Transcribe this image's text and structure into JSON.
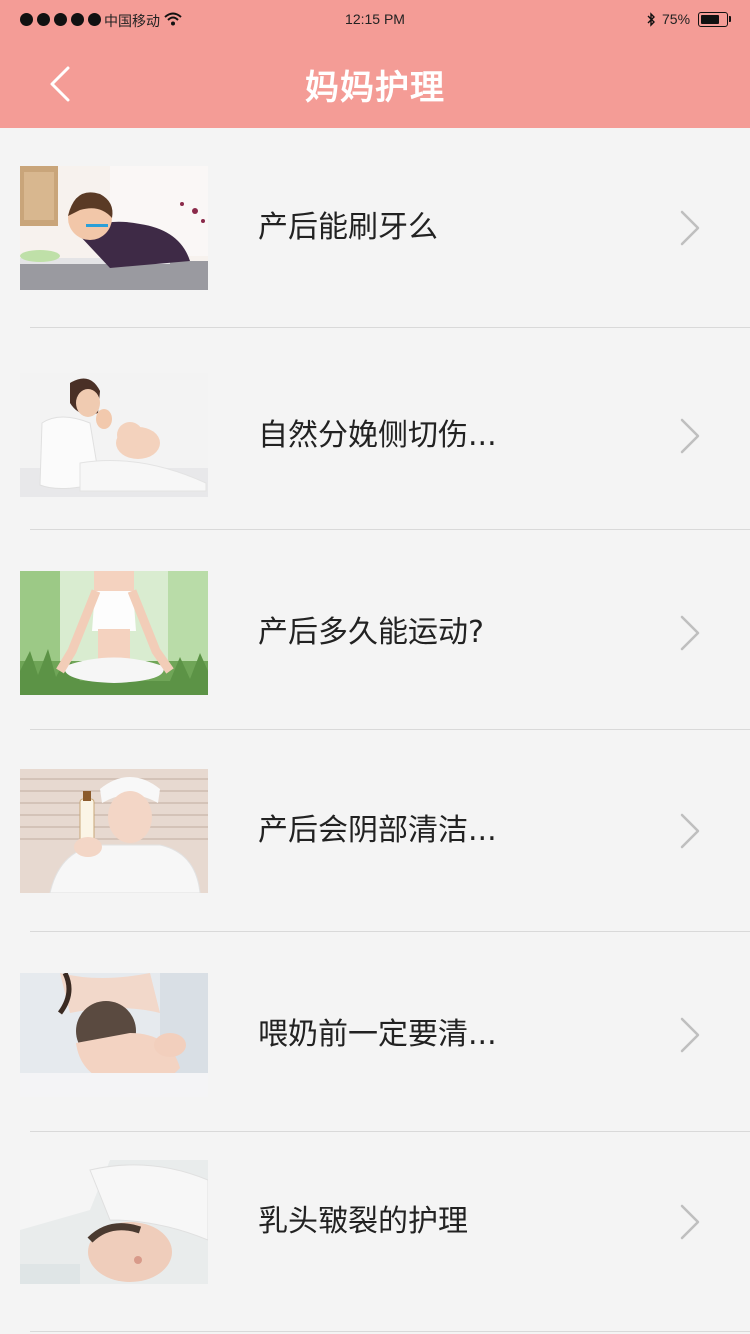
{
  "status_bar": {
    "carrier": "中国移动",
    "time": "12:15 PM",
    "battery": "75%",
    "battery_level": 0.75
  },
  "nav": {
    "title": "妈妈护理",
    "back_icon": "chevron-left-icon"
  },
  "colors": {
    "header": "#f49c96",
    "background": "#f4f4f4",
    "divider": "#d9d9d9",
    "chevron": "#bfbfbf"
  },
  "articles": [
    {
      "title": "产后能刷牙么"
    },
    {
      "title": "自然分娩侧切伤..."
    },
    {
      "title": "产后多久能运动?"
    },
    {
      "title": "产后会阴部清洁..."
    },
    {
      "title": "喂奶前一定要清..."
    },
    {
      "title": "乳头皲裂的护理"
    }
  ]
}
